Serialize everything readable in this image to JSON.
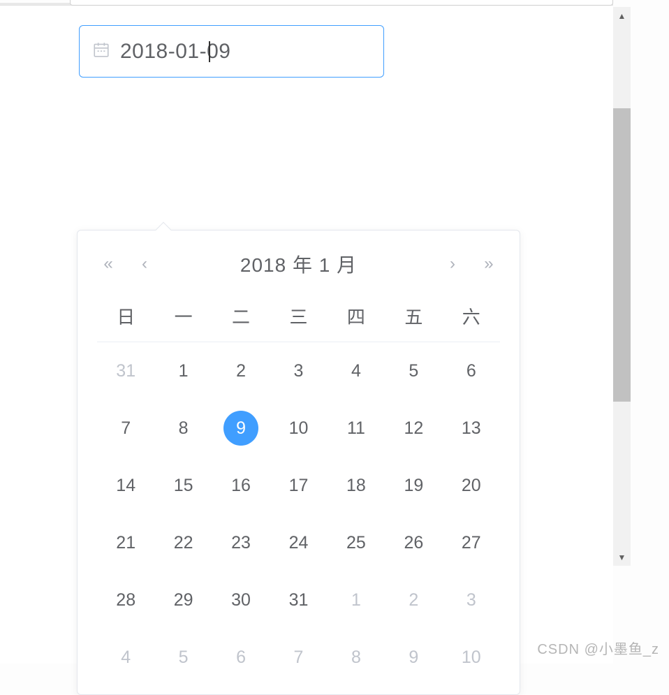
{
  "input": {
    "value": "2018-01-09"
  },
  "calendar": {
    "title": "2018 年  1 月",
    "nav": {
      "prev_year": "«",
      "prev_month": "‹",
      "next_month": "›",
      "next_year": "»"
    },
    "weekdays": [
      "日",
      "一",
      "二",
      "三",
      "四",
      "五",
      "六"
    ],
    "days": [
      {
        "d": "31",
        "other": true
      },
      {
        "d": "1"
      },
      {
        "d": "2"
      },
      {
        "d": "3"
      },
      {
        "d": "4"
      },
      {
        "d": "5"
      },
      {
        "d": "6"
      },
      {
        "d": "7"
      },
      {
        "d": "8"
      },
      {
        "d": "9",
        "selected": true
      },
      {
        "d": "10"
      },
      {
        "d": "11"
      },
      {
        "d": "12"
      },
      {
        "d": "13"
      },
      {
        "d": "14"
      },
      {
        "d": "15"
      },
      {
        "d": "16"
      },
      {
        "d": "17"
      },
      {
        "d": "18"
      },
      {
        "d": "19"
      },
      {
        "d": "20"
      },
      {
        "d": "21"
      },
      {
        "d": "22"
      },
      {
        "d": "23"
      },
      {
        "d": "24"
      },
      {
        "d": "25"
      },
      {
        "d": "26"
      },
      {
        "d": "27"
      },
      {
        "d": "28"
      },
      {
        "d": "29"
      },
      {
        "d": "30"
      },
      {
        "d": "31"
      },
      {
        "d": "1",
        "other": true
      },
      {
        "d": "2",
        "other": true
      },
      {
        "d": "3",
        "other": true
      },
      {
        "d": "4",
        "other": true
      },
      {
        "d": "5",
        "other": true
      },
      {
        "d": "6",
        "other": true
      },
      {
        "d": "7",
        "other": true
      },
      {
        "d": "8",
        "other": true
      },
      {
        "d": "9",
        "other": true
      },
      {
        "d": "10",
        "other": true
      }
    ]
  },
  "watermark": "CSDN @小墨鱼_z"
}
